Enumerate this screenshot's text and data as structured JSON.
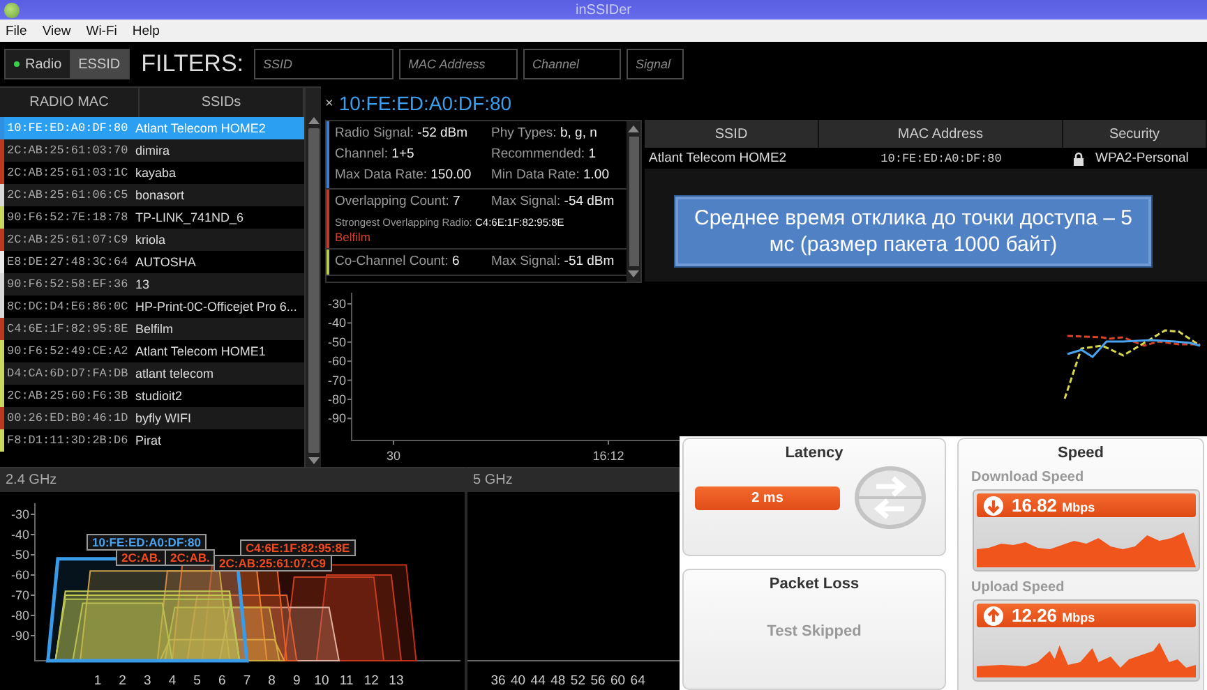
{
  "window": {
    "title": "inSSIDer"
  },
  "menu": [
    "File",
    "View",
    "Wi-Fi",
    "Help"
  ],
  "toolbar": {
    "modes": [
      {
        "label": "Radio",
        "selected": true
      },
      {
        "label": "ESSID",
        "selected": false
      }
    ],
    "filters_label": "FILTERS:",
    "filters": [
      {
        "placeholder": "SSID"
      },
      {
        "placeholder": "MAC Address"
      },
      {
        "placeholder": "Channel"
      },
      {
        "placeholder": "Signal"
      }
    ]
  },
  "network_list": {
    "columns": [
      "RADIO MAC",
      "SSIDs"
    ],
    "rows": [
      {
        "mac": "10:FE:ED:A0:DF:80",
        "ssid": "Atlant Telecom HOME2",
        "color": "#2f8fe0",
        "selected": true
      },
      {
        "mac": "2C:AB:25:61:03:70",
        "ssid": "dimira",
        "color": "#c0391f",
        "selected": false
      },
      {
        "mac": "2C:AB:25:61:03:1C",
        "ssid": "kayaba",
        "color": "#c0391f",
        "selected": false
      },
      {
        "mac": "2C:AB:25:61:06:C5",
        "ssid": "bonasort",
        "color": "#d8d8d8",
        "selected": false
      },
      {
        "mac": "90:F6:52:7E:18:78",
        "ssid": "TP-LINK_741ND_6",
        "color": "#c8d860",
        "selected": false
      },
      {
        "mac": "2C:AB:25:61:07:C9",
        "ssid": "kriola",
        "color": "#c0391f",
        "selected": false
      },
      {
        "mac": "E8:DE:27:48:3C:64",
        "ssid": "AUTOSHA",
        "color": "#e8e8e8",
        "selected": false
      },
      {
        "mac": "90:F6:52:58:EF:36",
        "ssid": "13",
        "color": "#d8d8d8",
        "selected": false
      },
      {
        "mac": "8C:DC:D4:E6:86:0C",
        "ssid": "HP-Print-0C-Officejet Pro 6...",
        "color": "#d8d8d8",
        "selected": false
      },
      {
        "mac": "C4:6E:1F:82:95:8E",
        "ssid": "Belfilm",
        "color": "#c0391f",
        "selected": false
      },
      {
        "mac": "90:F6:52:49:CE:A2",
        "ssid": "Atlant Telecom HOME1",
        "color": "#c8d860",
        "selected": false
      },
      {
        "mac": "D4:CA:6D:D7:FA:DB",
        "ssid": "atlant telecom",
        "color": "#c8d860",
        "selected": false
      },
      {
        "mac": "2C:AB:25:60:F6:3B",
        "ssid": "studioit2",
        "color": "#c8d860",
        "selected": false
      },
      {
        "mac": "00:26:ED:B0:46:1D",
        "ssid": "byfly WIFI",
        "color": "#c0391f",
        "selected": false
      },
      {
        "mac": "F8:D1:11:3D:2B:D6",
        "ssid": "Pirat",
        "color": "#c8d860",
        "selected": false
      }
    ]
  },
  "details": {
    "close": "×",
    "title": "10:FE:ED:A0:DF:80",
    "sections": [
      {
        "color": "#3b7fd0",
        "fields": [
          {
            "label": "Radio Signal:",
            "value": "-52 dBm"
          },
          {
            "label": "Phy Types:",
            "value": "b, g, n"
          },
          {
            "label": "Channel:",
            "value": "1+5"
          },
          {
            "label": "Recommended:",
            "value": "1"
          },
          {
            "label": "Max Data Rate:",
            "value": "150.00"
          },
          {
            "label": "Min Data Rate:",
            "value": "1.00"
          }
        ]
      },
      {
        "color": "#c0392b",
        "fields": [
          {
            "label": "Overlapping Count:",
            "value": "7"
          },
          {
            "label": "Max Signal:",
            "value": "-54 dBm"
          },
          {
            "label": "Strongest Overlapping Radio:",
            "value": "C4:6E:1F:82:95:8E"
          }
        ],
        "note": "Belfilm"
      },
      {
        "color": "#b8c850",
        "fields": [
          {
            "label": "Co-Channel Count:",
            "value": "6"
          },
          {
            "label": "Max Signal:",
            "value": "-51 dBm"
          }
        ]
      }
    ]
  },
  "ap_table": {
    "columns": [
      "SSID",
      "MAC Address",
      "Security"
    ],
    "rows": [
      {
        "ssid": "Atlant Telecom HOME2",
        "mac": "10:FE:ED:A0:DF:80",
        "security": "WPA2-Personal"
      }
    ]
  },
  "signal_graph": {
    "yticks": [
      "-30",
      "-40",
      "-50",
      "-60",
      "-70",
      "-80",
      "-90"
    ],
    "xlabels": [
      "30",
      "16:12"
    ]
  },
  "bands": [
    {
      "kind": "narrowband",
      "title": "2.4 GHz",
      "yticks": [
        "-30",
        "-40",
        "-50",
        "-60",
        "-70",
        "-80",
        "-90"
      ],
      "xticks": [
        "1",
        "2",
        "3",
        "4",
        "5",
        "6",
        "7",
        "8",
        "9",
        "10",
        "11",
        "12",
        "13"
      ],
      "labels": [
        {
          "text": "10:FE:ED:A0:DF:80",
          "color": "#4aa3f0"
        },
        {
          "text": "C4:6E:1F:82:95:8E",
          "color": "#f04a20"
        },
        {
          "text": "2C:AB.",
          "color": "#f04a20"
        },
        {
          "text": "2C:AB.",
          "color": "#f04a20"
        },
        {
          "text": "2C:AB:25:61:07:C9",
          "color": "#f04a20"
        }
      ]
    },
    {
      "kind": "wideband",
      "title": "5 GHz",
      "xticks": [
        "36",
        "40",
        "44",
        "48",
        "52",
        "56",
        "60",
        "64"
      ]
    }
  ],
  "callout": {
    "text": "Среднее время отклика до точки доступа – 5 мс (размер пакета 1000 байт)"
  },
  "speed_test": {
    "latency": {
      "title": "Latency",
      "value": "2 ms"
    },
    "packet_loss": {
      "title": "Packet Loss",
      "status": "Test Skipped"
    },
    "speed": {
      "title": "Speed",
      "tests": [
        {
          "kind": "download",
          "label": "Download Speed",
          "value": "16.82",
          "unit": "Mbps"
        },
        {
          "kind": "upload",
          "label": "Upload Speed",
          "value": "12.26",
          "unit": "Mbps"
        }
      ]
    }
  }
}
